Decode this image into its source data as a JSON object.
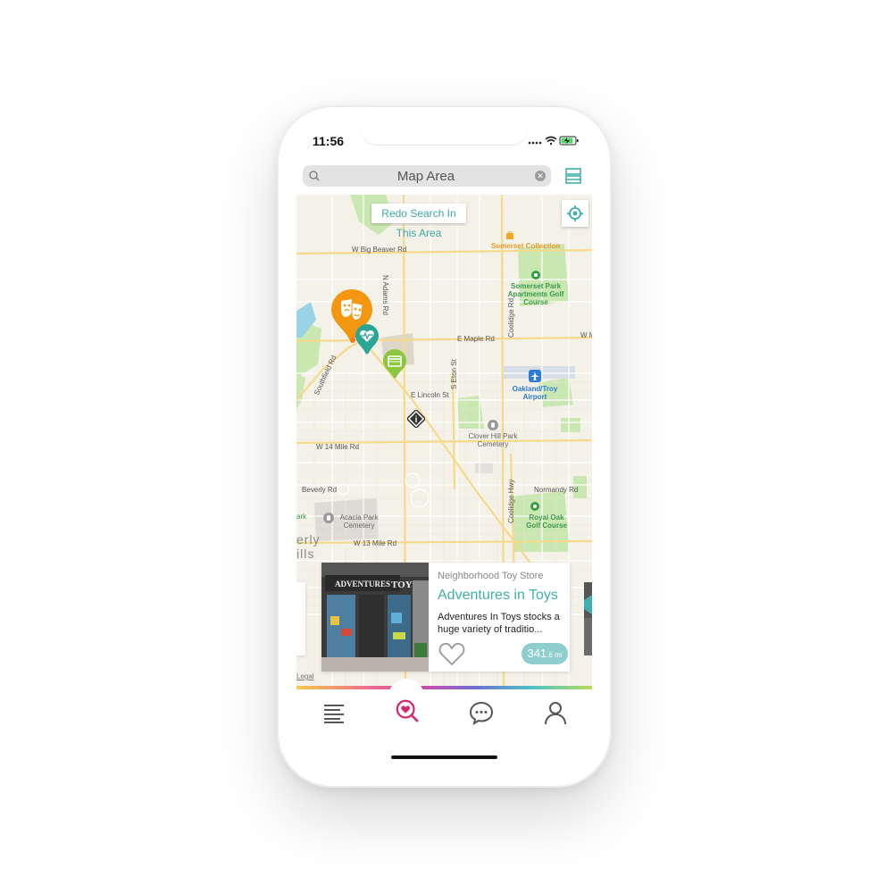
{
  "status_bar": {
    "time": "11:56"
  },
  "search": {
    "placeholder": "Map Area",
    "value": "Map Area"
  },
  "map": {
    "redo_search_label": "Redo Search In This Area",
    "labels": {
      "w_big_beaver": "W Big Beaver Rd",
      "n_adams": "N Adams Rd",
      "coolidge": "Coolidge Rd",
      "e_maple": "E Maple Rd",
      "w_m": "W M",
      "southfield": "Southfield Rd",
      "s_eton": "S Eton St",
      "e_lincoln": "E Lincoln St",
      "w_14_mile": "W 14 Mile Rd",
      "beverly": "Beverly Rd",
      "normandy": "Normandy Rd",
      "coolidge_hwy": "Coolidge Hwy",
      "w_13_mile": "W 13 Mile Rd",
      "legal": "Legal",
      "beverly_hills_1": "erly",
      "beverly_hills_2": "ills",
      "ark": "ark"
    },
    "places": {
      "somerset_collection": "Somerset Collection",
      "somerset_park": "Somerset Park Apartments Golf Course",
      "oakland_troy": "Oakland/Troy Airport",
      "clover_hill": "Clover Hill Park Cemetery",
      "acacia_park": "Acacia Park Cemetery",
      "royal_oak": "Royal Oak Golf Course"
    }
  },
  "card": {
    "category": "Neighborhood Toy Store",
    "title": "Adventures in Toys",
    "description": "Adventures In Toys stocks a huge variety of traditio...",
    "distance_value": "341",
    "distance_unit": ".6 mi",
    "photo_sign": "ADVENTURES IN TOYS"
  },
  "tabs": [
    {
      "name": "list",
      "icon": "list-icon"
    },
    {
      "name": "discover",
      "icon": "heart-search-icon"
    },
    {
      "name": "messages",
      "icon": "chat-icon"
    },
    {
      "name": "profile",
      "icon": "user-icon"
    }
  ],
  "colors": {
    "accent_teal": "#3fb0ae",
    "accent_pink": "#d6266f",
    "pin_orange": "#f2970f",
    "pin_teal": "#2aa596",
    "pin_green": "#8cc63f"
  }
}
